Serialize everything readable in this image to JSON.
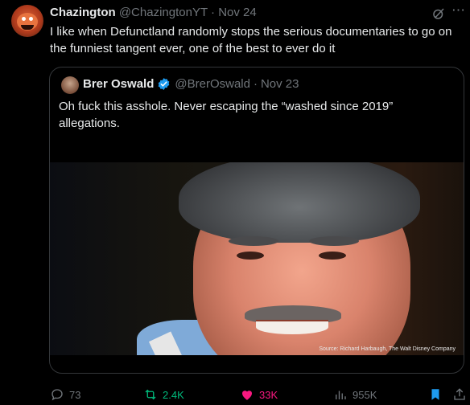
{
  "tweet": {
    "author_name": "Chazington",
    "author_handle": "@ChazingtonYT",
    "separator": "·",
    "date": "Nov 24",
    "text": "I like when Defunctland randomly stops the serious documentaries to go on the funniest tangent ever, one of the best to ever do it",
    "more_icon": "more-icon",
    "grok_icon": "grok-icon"
  },
  "quoted": {
    "author_name": "Brer Oswald",
    "author_handle": "@BrerOswald",
    "separator": "·",
    "date": "Nov 23",
    "verified": true,
    "text": "Oh fuck this asshole. Never escaping the “washed since 2019” allegations.",
    "image_credit": "Source: Richard Harbaugh, The Walt Disney Company"
  },
  "actions": {
    "replies": "73",
    "retweets": "2.4K",
    "likes": "33K",
    "views": "955K"
  },
  "colors": {
    "background": "#000000",
    "text": "#e7e9ea",
    "muted": "#71767b",
    "retweet": "#00ba7c",
    "like": "#f91880",
    "verified": "#1d9bf0",
    "bookmark": "#1d9bf0"
  }
}
